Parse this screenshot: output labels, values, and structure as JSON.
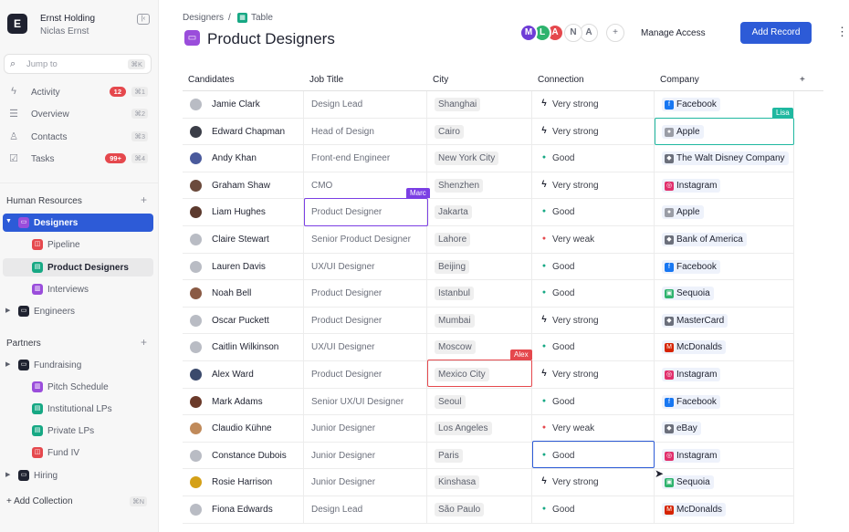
{
  "workspace": {
    "logo_letter": "E",
    "name": "Ernst Holding",
    "user": "Niclas Ernst",
    "collapse_icon": "sidebar-collapse-icon"
  },
  "jump": {
    "label": "Jump to",
    "shortcut": "⌘K"
  },
  "nav": [
    {
      "label": "Activity",
      "icon": "activity-icon",
      "badge": "12",
      "shortcut": "⌘1"
    },
    {
      "label": "Overview",
      "icon": "list-icon",
      "badge": "",
      "shortcut": "⌘2"
    },
    {
      "label": "Contacts",
      "icon": "contacts-icon",
      "badge": "",
      "shortcut": "⌘3"
    },
    {
      "label": "Tasks",
      "icon": "check-icon",
      "badge": "99+",
      "shortcut": "⌘4"
    }
  ],
  "sections": {
    "human_resources": "Human Resources",
    "partners": "Partners"
  },
  "tree_hr": [
    {
      "label": "Designers"
    },
    {
      "label": "Pipeline"
    },
    {
      "label": "Product Designers"
    },
    {
      "label": "Interviews"
    },
    {
      "label": "Engineers"
    }
  ],
  "tree_partners": [
    {
      "label": "Fundraising"
    },
    {
      "label": "Pitch Schedule"
    },
    {
      "label": "Institutional LPs"
    },
    {
      "label": "Private LPs"
    },
    {
      "label": "Fund IV"
    },
    {
      "label": "Hiring"
    }
  ],
  "add_collection": {
    "label": "+ Add Collection",
    "shortcut": "⌘N"
  },
  "breadcrumb": {
    "parent": "Designers",
    "separator": "/",
    "view": "Table"
  },
  "page_title": "Product Designers",
  "avatars": [
    {
      "letter": "M",
      "color": "#6e3cd6"
    },
    {
      "letter": "L",
      "color": "#2fb36e"
    },
    {
      "letter": "A",
      "color": "#e5484d"
    },
    {
      "letter": "N",
      "color": "#ffffff"
    },
    {
      "letter": "A",
      "color": "#ffffff"
    }
  ],
  "toolbar": {
    "add_collab": "+",
    "manage_access": "Manage Access",
    "add_record": "Add Record",
    "more": "⋮"
  },
  "columns": [
    "Candidates",
    "Job Title",
    "City",
    "Connection",
    "Company",
    "+"
  ],
  "rows": [
    {
      "name": "Jamie Clark",
      "job": "Design Lead",
      "city": "Shanghai",
      "conn": "Very strong",
      "company": "Facebook"
    },
    {
      "name": "Edward Chapman",
      "job": "Head of Design",
      "city": "Cairo",
      "conn": "Very strong",
      "company": "Apple"
    },
    {
      "name": "Andy Khan",
      "job": "Front-end Engineer",
      "city": "New York City",
      "conn": "Good",
      "company": "The Walt Disney Company"
    },
    {
      "name": "Graham Shaw",
      "job": "CMO",
      "city": "Shenzhen",
      "conn": "Very strong",
      "company": "Instagram"
    },
    {
      "name": "Liam Hughes",
      "job": "Product Designer",
      "city": "Jakarta",
      "conn": "Good",
      "company": "Apple"
    },
    {
      "name": "Claire Stewart",
      "job": "Senior Product Designer",
      "city": "Lahore",
      "conn": "Very weak",
      "company": "Bank of America"
    },
    {
      "name": "Lauren Davis",
      "job": "UX/UI Designer",
      "city": "Beijing",
      "conn": "Good",
      "company": "Facebook"
    },
    {
      "name": "Noah Bell",
      "job": "Product Designer",
      "city": "Istanbul",
      "conn": "Good",
      "company": "Sequoia"
    },
    {
      "name": "Oscar Puckett",
      "job": "Product Designer",
      "city": "Mumbai",
      "conn": "Very strong",
      "company": "MasterCard"
    },
    {
      "name": "Caitlin Wilkinson",
      "job": "UX/UI Designer",
      "city": "Moscow",
      "conn": "Good",
      "company": "McDonalds"
    },
    {
      "name": "Alex Ward",
      "job": "Product Designer",
      "city": "Mexico City",
      "conn": "Very strong",
      "company": "Instagram"
    },
    {
      "name": "Mark Adams",
      "job": "Senior UX/UI Designer",
      "city": "Seoul",
      "conn": "Good",
      "company": "Facebook"
    },
    {
      "name": "Claudio Kühne",
      "job": "Junior Designer",
      "city": "Los Angeles",
      "conn": "Very weak",
      "company": "eBay"
    },
    {
      "name": "Constance Dubois",
      "job": "Junior Designer",
      "city": "Paris",
      "conn": "Good",
      "company": "Instagram"
    },
    {
      "name": "Rosie Harrison",
      "job": "Junior Designer",
      "city": "Kinshasa",
      "conn": "Very strong",
      "company": "Sequoia"
    },
    {
      "name": "Fiona Edwards",
      "job": "Design Lead",
      "city": "São Paulo",
      "conn": "Good",
      "company": "McDonalds"
    }
  ],
  "collab_tags": {
    "lisa": "Lisa",
    "marc": "Marc",
    "alex": "Alex"
  },
  "colors": {
    "accent": "#2d5bd7",
    "good": "#17a884",
    "weak": "#e5484d",
    "lisa": "#1fb8a0",
    "marc": "#7b3fe4",
    "alex": "#e5484d"
  }
}
